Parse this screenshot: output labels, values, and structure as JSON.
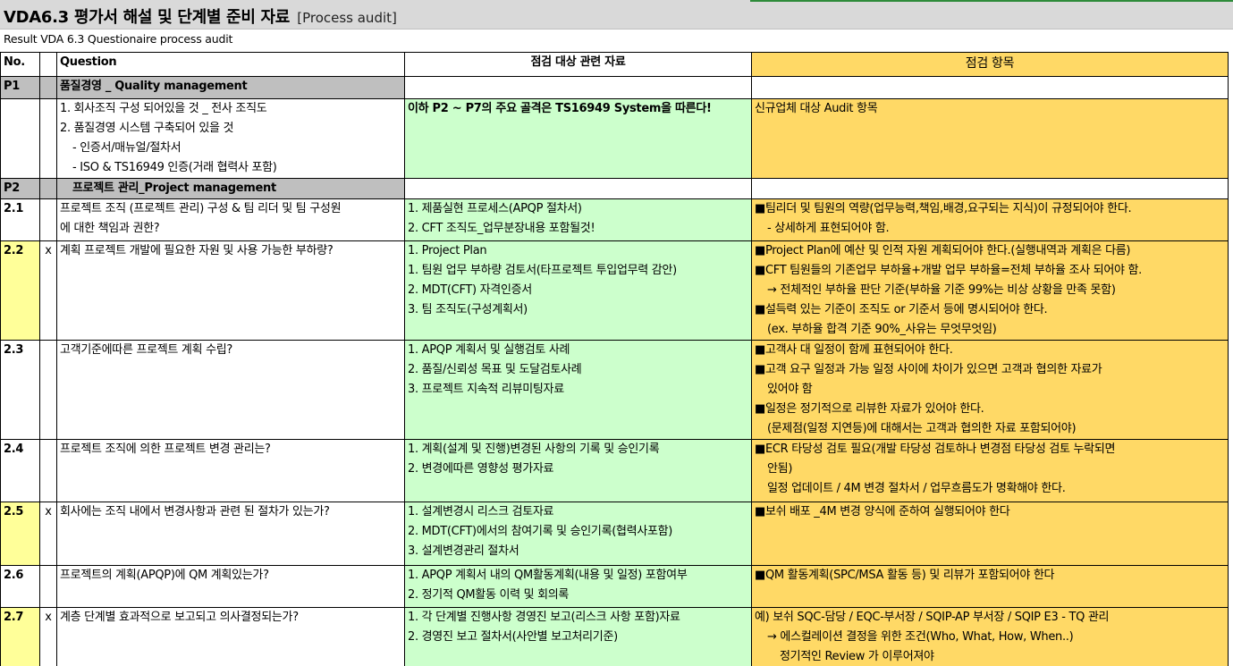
{
  "header": {
    "title": "VDA6.3 평가서 해설 및 단계별 준비 자료",
    "title_suffix": "[Process audit]",
    "subtitle": "Result VDA 6.3 Questionaire process audit"
  },
  "columns": {
    "no": "No.",
    "question": "Question",
    "materials": "점검 대상 관련 자료",
    "check": "점검 항목"
  },
  "sections": {
    "p1": {
      "no": "P1",
      "title": "품질경영 _ Quality management"
    },
    "p2": {
      "no": "P2",
      "title": "프로젝트 관리_Project management"
    }
  },
  "rows": {
    "p1": {
      "q": [
        "1. 회사조직 구성 되어있을 것 _ 전사 조직도",
        "2. 품질경영 시스템 구축되어 있을 것",
        "- 인증서/매뉴얼/절차서",
        "- ISO & TS16949 인증(거래 협력사 포함)"
      ],
      "m": [
        "이하 P2 ~ P7의 주요 골격은 TS16949 System을 따른다!"
      ],
      "c": [
        "신규업체 대상 Audit 항목"
      ]
    },
    "r21": {
      "no": "2.1",
      "x": "",
      "q": [
        "프로젝트 조직 (프로젝트 관리) 구성 & 팀 리더 및 팀 구성원",
        "에 대한 책임과 권한?"
      ],
      "m": [
        "1. 제품실현 프로세스(APQP 절차서)",
        "2. CFT 조직도_업무분장내용 포함될것!"
      ],
      "c": [
        "■팀리더 및 팀원의 역량(업무능력,책임,배경,요구되는 지식)이 규정되어야 한다.",
        "- 상세하게 표현되어야 함."
      ]
    },
    "r22": {
      "no": "2.2",
      "x": "x",
      "q": [
        "계획 프로젝트 개발에 필요한 자원 및 사용 가능한 부하량?"
      ],
      "m": [
        "1. Project Plan",
        "1. 팀원 업무 부하량 검토서(타프로젝트 투입업무력 감안)",
        "2. MDT(CFT) 자격인증서",
        "3. 팀 조직도(구성계획서)"
      ],
      "c": [
        "■Project Plan에 예산 및  인적 자원 계획되어야 한다.(실행내역과 계획은 다름)",
        "■CFT 팀원들의 기존업무 부하율+개발 업무 부하율=전체 부하율 조사 되어야 함.",
        "→ 전체적인 부하율 판단 기준(부하율 기준 99%는 비상 상황을 만족 못함)",
        "■설득력 있는 기준이 조직도 or 기준서 등에 명시되어야 한다.",
        "(ex. 부하율 합격 기준 90%_사유는 무엇무엇임)"
      ]
    },
    "r23": {
      "no": "2.3",
      "x": "",
      "q": [
        "고객기준에따른 프로젝트 계획 수립?"
      ],
      "m": [
        "1. APQP 계획서 및 실행검토 사례",
        "2. 품질/신뢰성 목표 및 도달검토사례",
        "3. 프로젝트 지속적 리뷰미팅자료"
      ],
      "c": [
        "■고객사 대 일정이 함께 표현되어야 한다.",
        "■고객 요구 일정과 가능 일정 사이에 차이가 있으면 고객과 협의한 자료가",
        "있어야 함",
        "■일정은 정기적으로 리뷰한 자료가 있어야 한다.",
        "(문제점(일정 지연등)에 대해서는 고객과 협의한 자료 포함되어야)"
      ]
    },
    "r24": {
      "no": "2.4",
      "x": "",
      "q": [
        "프로젝트 조직에 의한 프로젝트 변경 관리는?"
      ],
      "m": [
        "1. 계획(설계 및 진행)변경된 사항의 기록 및 승인기록",
        "2. 변경에따른 영향성 평가자료"
      ],
      "c": [
        "■ECR 타당성 검토 필요(개발 타당성 검토하나 변경점 타당성 검토 누락되면",
        "안됨)",
        "일정 업데이트 / 4M 변경 절차서 / 업무흐름도가 명확해야 한다."
      ]
    },
    "r25": {
      "no": "2.5",
      "x": "x",
      "q": [
        "회사에는 조직 내에서 변경사항과 관련 된 절차가 있는가?"
      ],
      "m": [
        "1. 설계변경시 리스크 검토자료",
        "2. MDT(CFT)에서의 참여기록 및 승인기록(협력사포함)",
        "3. 설계변경관리 절차서"
      ],
      "c": [
        "■보쉬 배포 _4M 변경 양식에 준하여 실행되어야 한다"
      ]
    },
    "r26": {
      "no": "2.6",
      "x": "",
      "q": [
        "프로젝트의 계획(APQP)에 QM 계획있는가?"
      ],
      "m": [
        "1. APQP 계획서 내의 QM활동계획(내용 및 일정) 포함여부",
        "2. 정기적 QM활동 이력 및 회의록"
      ],
      "c": [
        "■QM 활동계획(SPC/MSA 활동 등) 및 리뷰가 포함되어야 한다"
      ]
    },
    "r27": {
      "no": "2.7",
      "x": "x",
      "q": [
        "계층 단계별 효과적으로 보고되고 의사결정되는가?"
      ],
      "m": [
        "1. 각 단계별 진행사항 경영진 보고(리스크 사항 포함)자료",
        "2. 경영진 보고 절차서(사안별 보고처리기준)"
      ],
      "c": [
        "예) 보쉬 SQC-담당 / EQC-부서장 / SQIP-AP 부서장 / SQIP E3 - TQ 관리",
        "→ 에스컬레이션 결정을 위한 조건(Who, What, How, When..)",
        "정기적인 Review 가 이루어져야"
      ]
    }
  },
  "colors": {
    "header_gray": "#d9d9d9",
    "section_gray": "#bfbfbf",
    "materials_green": "#ccffcc",
    "check_gold": "#ffd966",
    "flag_yellow": "#ffff99"
  }
}
